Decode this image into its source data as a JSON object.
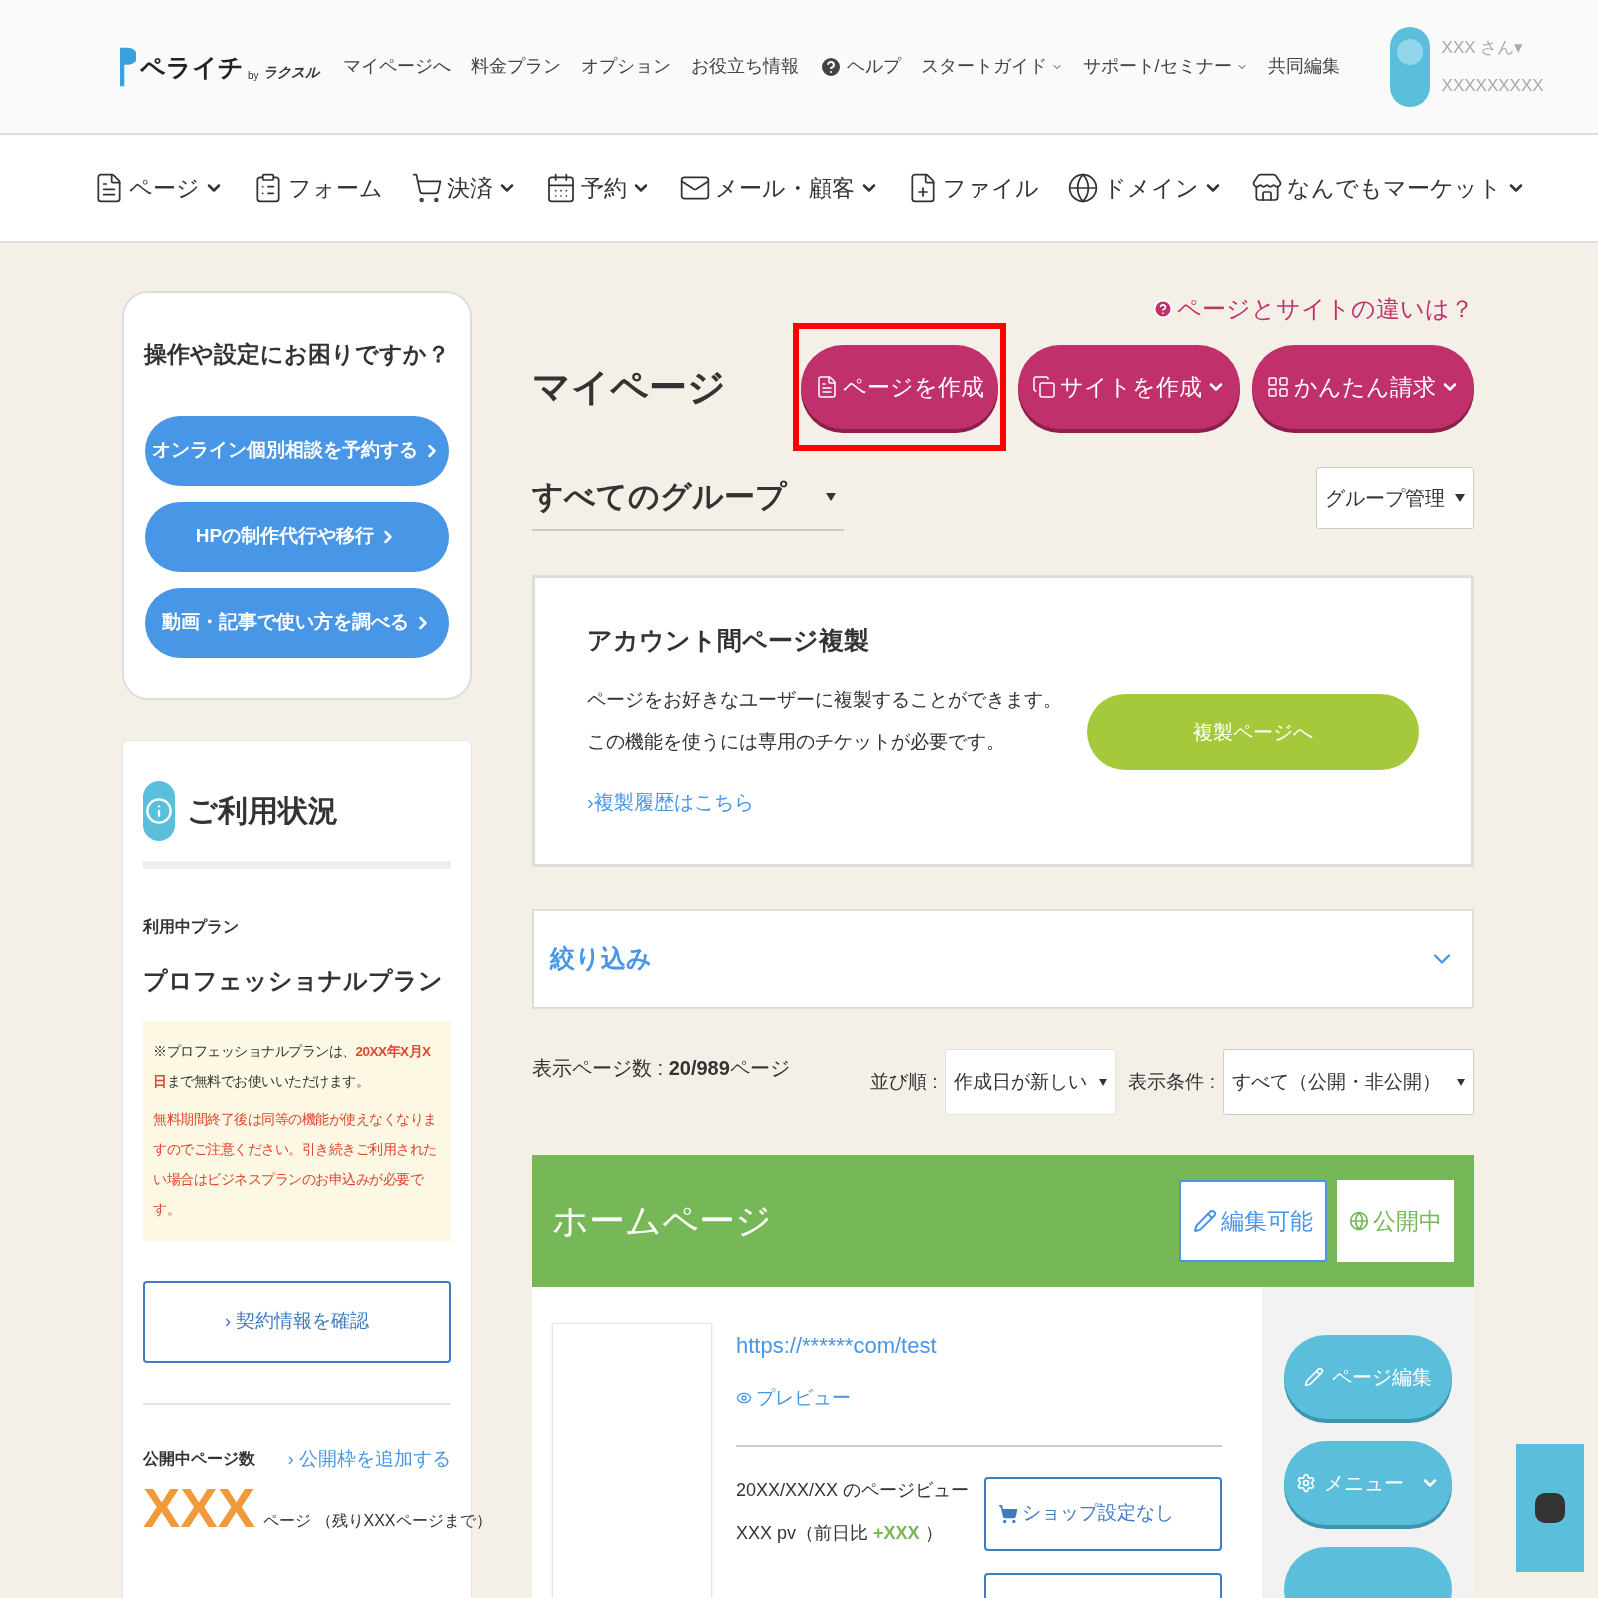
{
  "header": {
    "logo": "ペライチ",
    "logo_by": "by",
    "logo_brand": "ラクスル",
    "nav": [
      {
        "label": "マイページへ",
        "kind": "link"
      },
      {
        "label": "料金プラン",
        "kind": "link"
      },
      {
        "label": "オプション",
        "kind": "link"
      },
      {
        "label": "お役立ち情報",
        "kind": "link"
      },
      {
        "label": "ヘルプ",
        "kind": "help"
      },
      {
        "label": "スタートガイド",
        "kind": "dropdown"
      },
      {
        "label": "サポート/セミナー",
        "kind": "dropdown"
      },
      {
        "label": "共同編集",
        "kind": "link"
      }
    ],
    "user": {
      "name": "XXX さん▾",
      "id": "XXXXXXXXX"
    }
  },
  "menu": [
    {
      "label": "ページ",
      "dropdown": true
    },
    {
      "label": "フォーム",
      "dropdown": false
    },
    {
      "label": "決済",
      "dropdown": true
    },
    {
      "label": "予約",
      "dropdown": true
    },
    {
      "label": "メール・顧客",
      "dropdown": true
    },
    {
      "label": "ファイル",
      "dropdown": false
    },
    {
      "label": "ドメイン",
      "dropdown": true
    },
    {
      "label": "なんでもマーケット",
      "dropdown": true
    }
  ],
  "help_card": {
    "title": "操作や設定にお困りですか？",
    "buttons": [
      "オンライン個別相談を予約する",
      "HPの制作代行や移行",
      "動画・記事で使い方を調べる"
    ]
  },
  "usage": {
    "title": "ご利用状況",
    "plan_label": "利用中プラン",
    "plan": "プロフェッショナルプラン",
    "notice": "※プロフェッショナルプランは、**20XX年X月X日**まで無料でお使いいただけます。",
    "warning": "無料期間終了後は同等の機能が使えなくなりますのでご注意ください。引き続きご利用されたい場合はビジネスプランのお申込みが必要です。",
    "contract_button": "› 契約情報を確認",
    "published_label": "公開中ページ数",
    "add_link": "› 公開枠を追加する",
    "count": "XXX",
    "count_suffix": "ページ （残りXXXページまで）"
  },
  "main": {
    "help_link": "ページとサイトの違いは？",
    "title": "マイページ",
    "actions": [
      {
        "label": "ページを作成",
        "dropdown": false,
        "highlighted": true
      },
      {
        "label": "サイトを作成",
        "dropdown": true,
        "highlighted": false
      },
      {
        "label": "かんたん請求",
        "dropdown": true,
        "highlighted": false
      }
    ],
    "group_select": "すべてのグループ",
    "group_manage": "グループ管理",
    "copy_card": {
      "title": "アカウント間ページ複製",
      "lines": [
        "ページをお好きなユーザーに複製することができます。",
        "この機能を使うには専用のチケットが必要です。"
      ],
      "history_link": "›複製履歴はこちら",
      "button": "複製ページへ"
    },
    "filter": {
      "label": "絞り込み",
      "expanded": false
    },
    "count_text": "表示ページ数 : **20/989**ページ",
    "sort_label": "並び順 :",
    "sort_value": "作成日が新しい",
    "cond_label": "表示条件 :",
    "cond_value": "すべて（公開・非公開）",
    "page_card": {
      "title": "ホームページ",
      "badges": [
        {
          "label": "編集可能",
          "kind": "editable"
        },
        {
          "label": "公開中",
          "kind": "published"
        }
      ],
      "url": "https://******com/test",
      "preview": "プレビュー",
      "views_label": "20XX/XX/XX のページビュー",
      "views": "XXX pv（前日比 **+XXX** ）",
      "shop": "ショップ設定なし",
      "side_buttons": [
        {
          "label": "ページ編集",
          "dropdown": false
        },
        {
          "label": "メニュー",
          "dropdown": true
        }
      ]
    }
  }
}
